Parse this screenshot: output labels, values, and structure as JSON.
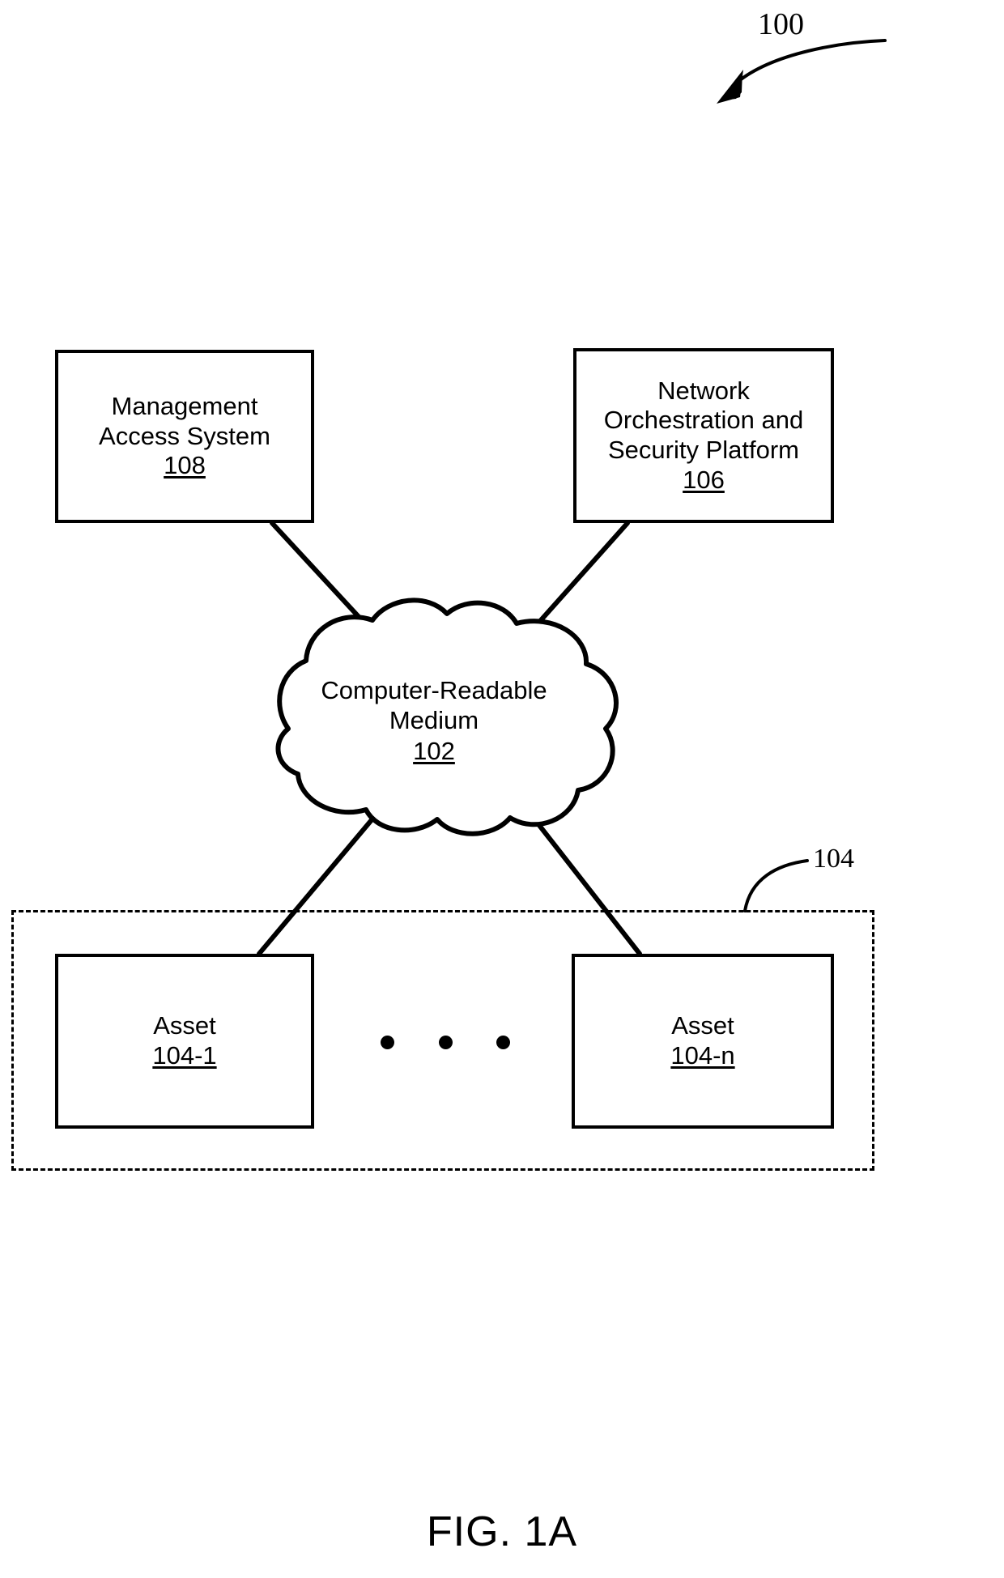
{
  "figure": {
    "caption": "FIG. 1A",
    "system_reference": "100",
    "group_reference": "104"
  },
  "nodes": {
    "management_access_system": {
      "line1": "Management",
      "line2": "Access System",
      "ref": "108"
    },
    "network_orchestration_platform": {
      "line1": "Network",
      "line2": "Orchestration and",
      "line3": "Security Platform",
      "ref": "106"
    },
    "computer_readable_medium": {
      "line1": "Computer-Readable",
      "line2": "Medium",
      "ref": "102"
    },
    "asset_first": {
      "line1": "Asset",
      "ref": "104-1"
    },
    "asset_last": {
      "line1": "Asset",
      "ref": "104-n"
    }
  },
  "colors": {
    "stroke": "#000000",
    "background": "#ffffff"
  }
}
